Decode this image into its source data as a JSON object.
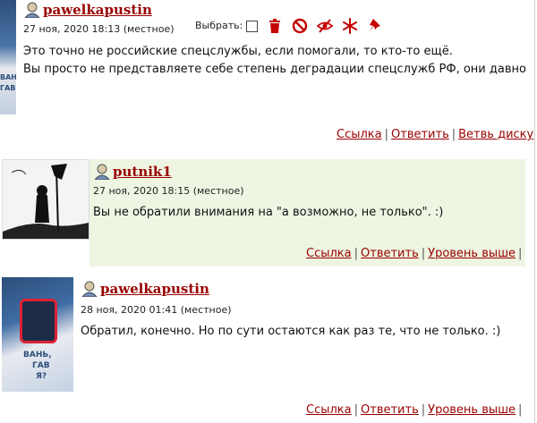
{
  "comments": [
    {
      "username": "pawelkapustin",
      "timestamp": "27 ноя, 2020 18:13 (местное)",
      "select_label": "Выбрать:",
      "lines": [
        "Это точно не российские спецслужбы, если помогали, то кто-то ещё.",
        "Вы просто не представляете себе степень деградации спецслужб РФ, они давно"
      ],
      "links": [
        "Ссылка",
        "Ответить",
        "Ветвь диску"
      ],
      "avatar_text": [
        "ВАНЬ,",
        "ГАВ"
      ]
    },
    {
      "username": "putnik1",
      "timestamp": "27 ноя, 2020 18:15 (местное)",
      "lines": [
        "Вы не обратили внимания на \"а возможно, не только\". :)"
      ],
      "links": [
        "Ссылка",
        "Ответить",
        "Уровень выше"
      ]
    },
    {
      "username": "pawelkapustin",
      "timestamp": "28 ноя, 2020 01:41 (местное)",
      "lines": [
        "Обратил, конечно. Но по сути остаются как раз те, что не только. :)"
      ],
      "links": [
        "Ссылка",
        "Ответить",
        "Уровень выше"
      ],
      "avatar_text": [
        "ВАНЬ,",
        "ГАВ",
        "Я?"
      ]
    }
  ],
  "colors": {
    "link": "#990000",
    "tool_icon": "#c40000",
    "highlight_bg": "#eef5e2"
  }
}
